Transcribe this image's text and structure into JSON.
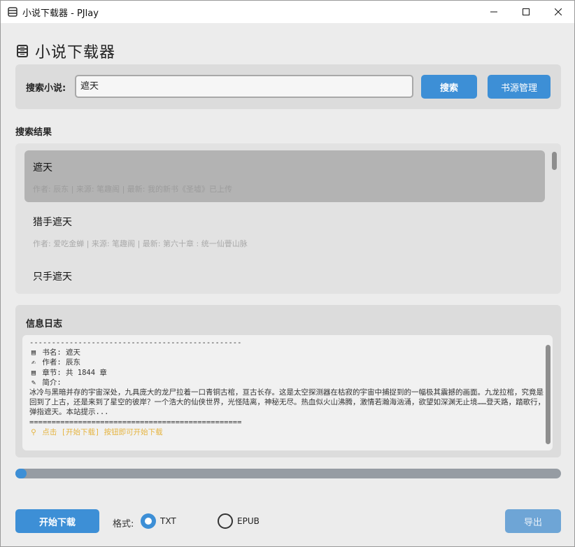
{
  "window": {
    "title": "小说下载器 - PJlay"
  },
  "header": {
    "title": "小说下载器"
  },
  "search": {
    "label": "搜索小说:",
    "value": "遮天",
    "search_button": "搜索",
    "source_button": "书源管理"
  },
  "results": {
    "heading": "搜索结果",
    "items": [
      {
        "title": "遮天",
        "meta": "作者: 辰东 | 来源: 笔趣阁 | 最新: 我的新书《圣墟》已上传",
        "selected": true
      },
      {
        "title": "猎手遮天",
        "meta": "作者: 爱吃金蝉 | 来源: 笔趣阁 | 最新: 第六十章 : 统一仙瞢山脉",
        "selected": false
      },
      {
        "title": "只手遮天",
        "meta": "",
        "selected": false
      }
    ]
  },
  "log": {
    "heading": "信息日志",
    "lines": {
      "dash_rule": "------------------------------------------------",
      "book_name": "书名: 遮天",
      "author": "作者: 辰东",
      "chapters": "章节: 共 1844 章",
      "intro_label": "简介:",
      "intro_text": "冰冷与黑暗并存的宇宙深处，九具庞大的龙尸拉着一口青铜古棺，亘古长存。这是太空探测器在枯寂的宇宙中捕捉到的一幅极其震撼的画面。九龙拉棺，究竟是回到了上古，还是来到了星空的彼岸？一个浩大的仙侠世界，光怪陆离，神秘无尽。热血似火山沸腾，激情若瀚海汹涌，欲望如深渊无止境……登天路，踏歌行，弹指遮天。本站提示...",
      "eq_rule": "================================================",
      "hint": "点击 [开始下载] 按钮即可开始下载"
    },
    "icons": {
      "book": "book-icon",
      "author": "pen-icon",
      "chapters": "pages-icon",
      "intro": "note-icon",
      "hint": "lightbulb-icon"
    }
  },
  "progress": {
    "value": 0.02
  },
  "bottom": {
    "start_button": "开始下载",
    "format_label": "格式:",
    "formats": [
      {
        "label": "TXT",
        "selected": true
      },
      {
        "label": "EPUB",
        "selected": false
      }
    ],
    "export_button": "导出"
  },
  "colors": {
    "accent": "#3d8fd6",
    "accent_disabled": "#6ea5d6",
    "hint": "#e5b440",
    "progress_track": "#969ca3"
  }
}
